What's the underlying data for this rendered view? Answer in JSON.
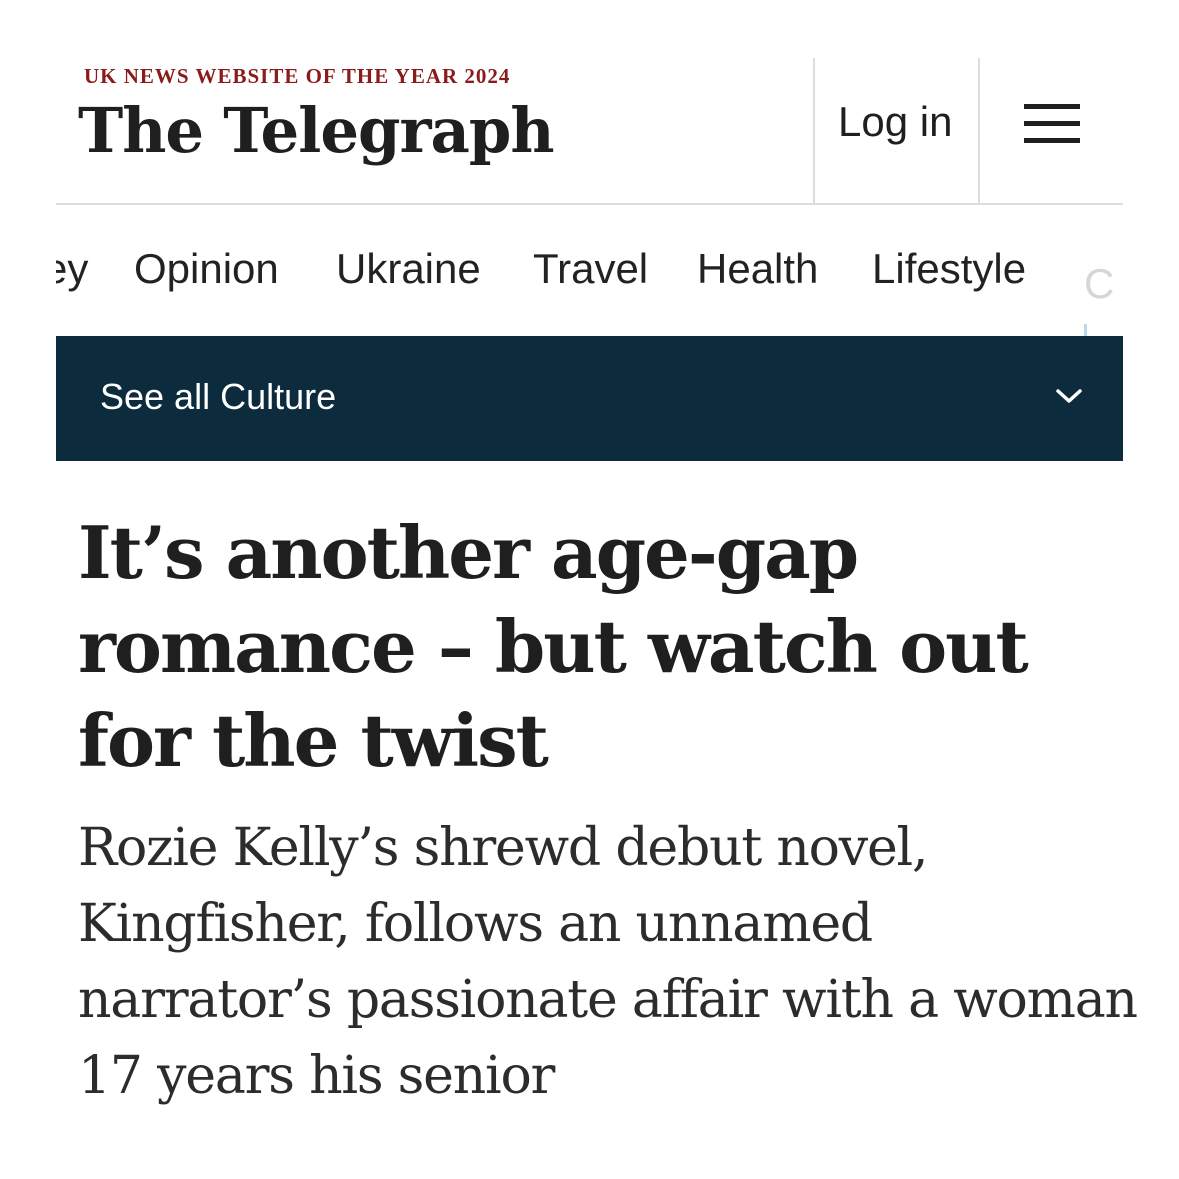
{
  "header": {
    "award": "UK NEWS WEBSITE OF THE YEAR 2024",
    "brand": "The Telegraph",
    "login_label": "Log in",
    "menu_icon": "hamburger-menu-icon"
  },
  "nav": {
    "items": [
      {
        "label": "ey"
      },
      {
        "label": "Opinion"
      },
      {
        "label": "Ukraine"
      },
      {
        "label": "Travel"
      },
      {
        "label": "Health"
      },
      {
        "label": "Lifestyle"
      },
      {
        "label": "C"
      }
    ]
  },
  "section_bar": {
    "label": "See all Culture",
    "icon": "chevron-down-icon",
    "background": "#0c2b3c"
  },
  "article": {
    "headline": "It’s another age-gap romance – but watch out for the twist",
    "standfirst": "Rozie Kelly’s shrewd debut novel, Kingfisher, follows an unnamed narrator’s passionate affair with a woman 17 years his senior"
  },
  "colors": {
    "award_red": "#8b1a1a",
    "text": "#1f1f1f"
  }
}
